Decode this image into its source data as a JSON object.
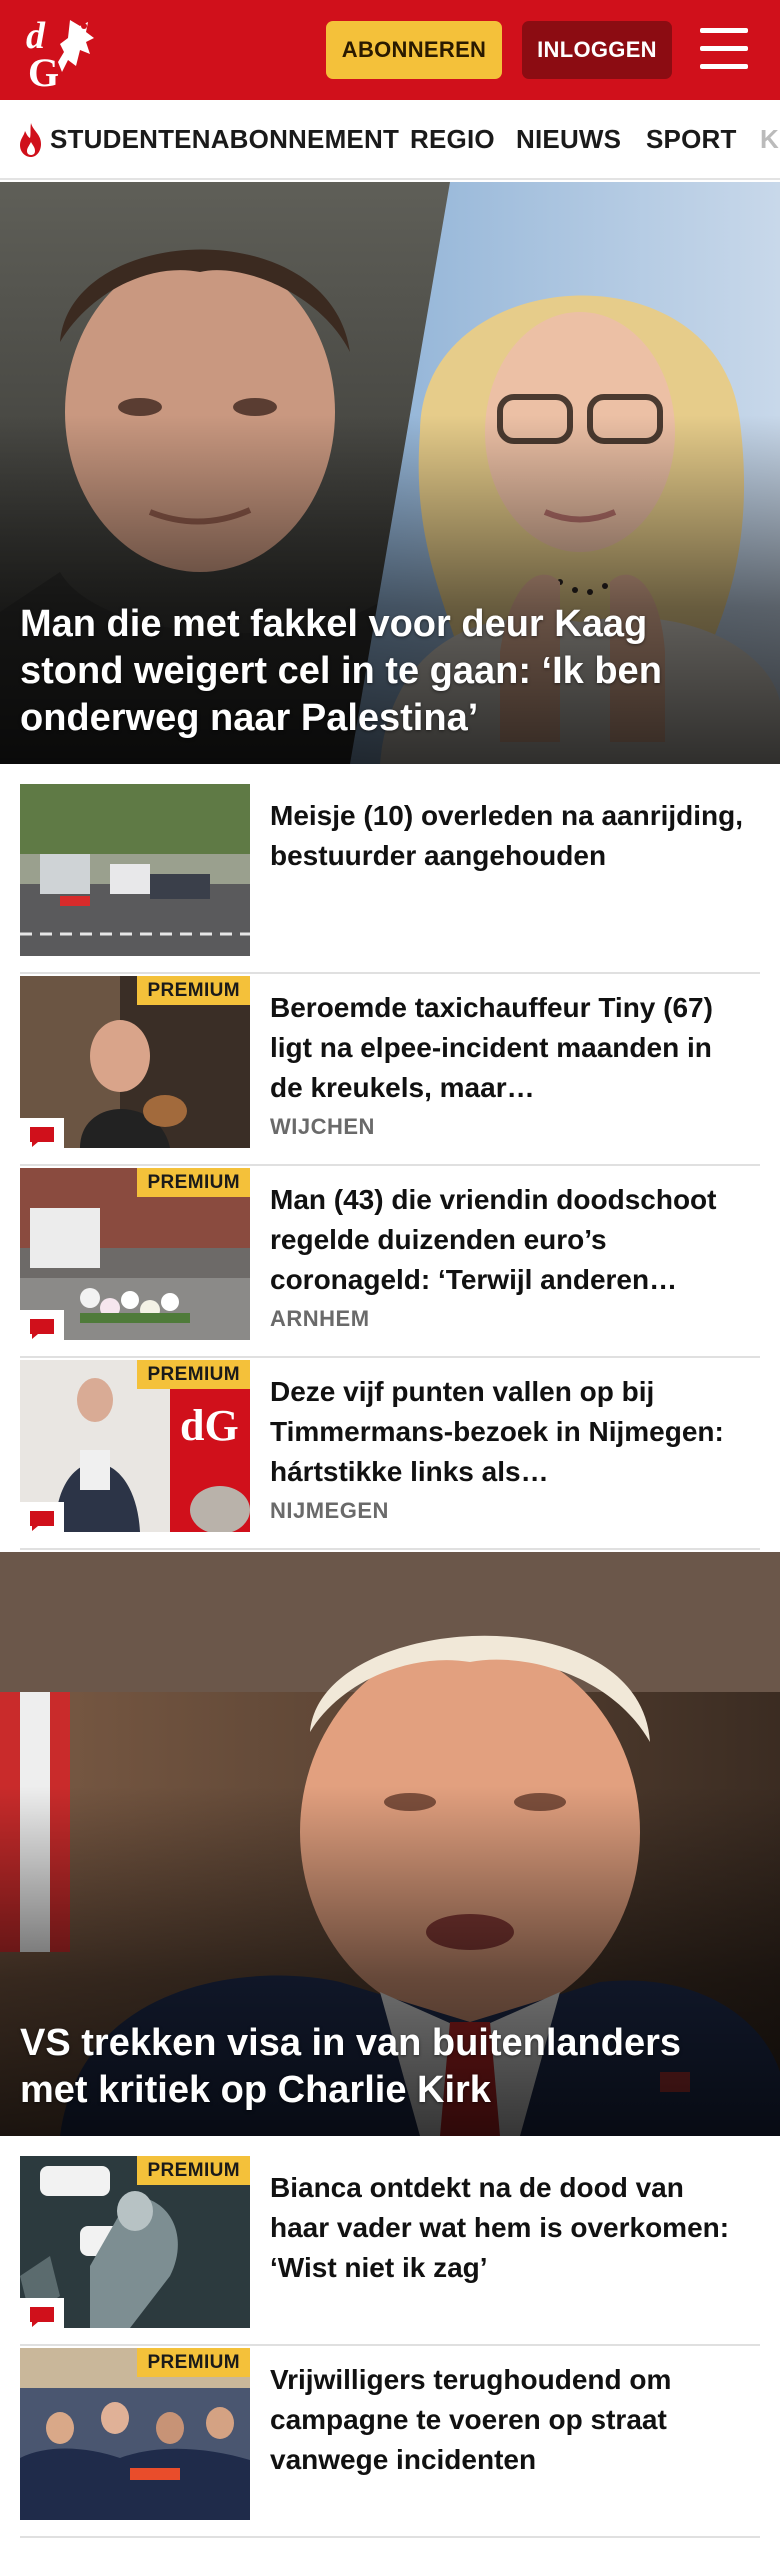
{
  "brand": {
    "logo_text": "dG",
    "red": "#d0101b",
    "dark_red": "#8c0c12",
    "yellow": "#f4c13a"
  },
  "header": {
    "subscribe_label": "ABONNEREN",
    "login_label": "INLOGGEN",
    "menu_icon": "hamburger-icon"
  },
  "nav": {
    "items": [
      {
        "label": "STUDENTENABONNEMENT",
        "icon": "flame-icon"
      },
      {
        "label": "REGIO"
      },
      {
        "label": "NIEUWS"
      },
      {
        "label": "SPORT"
      },
      {
        "label": "K"
      }
    ]
  },
  "hero1": {
    "title": "Man die met fakkel voor deur Kaag stond weigert cel in te gaan: ‘Ik ben onderweg naar Palestina’"
  },
  "articles_a": [
    {
      "title": "Meisje (10) overleden na aanrijding, bestuurder aangehouden",
      "region": "",
      "premium": "",
      "comments_icon": ""
    },
    {
      "title": "Beroemde taxichauffeur Tiny (67) ligt na elpee-incident maanden in de kreukels, maar…",
      "region": "WIJCHEN",
      "premium": "PREMIUM",
      "comments_icon": "comment-icon"
    },
    {
      "title": "Man (43) die vriendin doodschoot regelde duizenden euro’s coronageld: ‘Terwijl anderen…",
      "region": "ARNHEM",
      "premium": "PREMIUM",
      "comments_icon": "comment-icon"
    },
    {
      "title": "Deze vijf punten vallen op bij Timmermans-bezoek in Nijmegen: hártstikke links als…",
      "region": "NIJMEGEN",
      "premium": "PREMIUM",
      "comments_icon": "comment-icon"
    }
  ],
  "hero2": {
    "title": "VS trekken visa in van buitenlanders met kritiek op Charlie Kirk"
  },
  "articles_b": [
    {
      "title": "Bianca ontdekt na de dood van haar vader wat hem is overkomen: ‘Wist niet ik zag’",
      "region": "",
      "premium": "PREMIUM",
      "comments_icon": "comment-icon"
    },
    {
      "title": "Vrijwilligers terughoudend om campagne te voeren op straat vanwege incidenten",
      "region": "",
      "premium": "PREMIUM",
      "comments_icon": ""
    }
  ]
}
